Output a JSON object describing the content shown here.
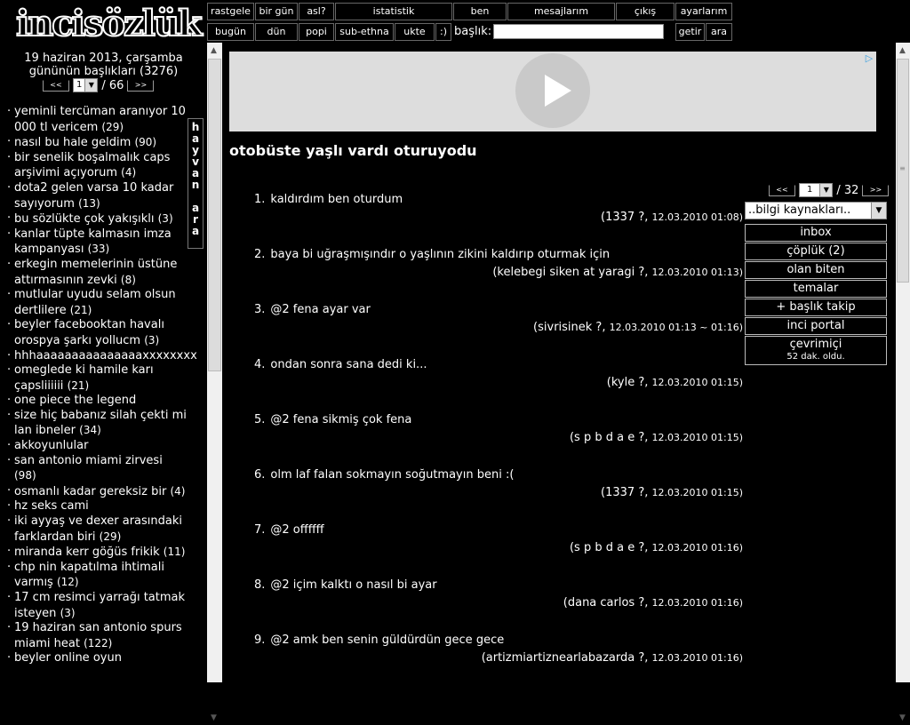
{
  "logo": {
    "text": "incisözlük"
  },
  "left": {
    "date_line1": "19 haziran 2013, çarşamba",
    "date_line2": "gününün başlıkları (3276)",
    "pager": {
      "prev": "<<",
      "page": "1",
      "total": "/ 66",
      "next": ">>"
    },
    "side_tab": [
      "h",
      "a",
      "y",
      "v",
      "a",
      "n",
      "",
      "a",
      "r",
      "a"
    ],
    "topics": [
      {
        "text": "yeminli tercüman aranıyor 10 000 tl vericem",
        "count": "(29)"
      },
      {
        "text": "nasıl bu hale geldim",
        "count": "(90)"
      },
      {
        "text": "bir senelik boşalmalık caps arşivimi açıyorum",
        "count": "(4)"
      },
      {
        "text": "dota2 gelen varsa 10 kadar sayıyorum",
        "count": "(13)"
      },
      {
        "text": "bu sözlükte çok yakışıklı",
        "count": "(3)"
      },
      {
        "text": "kanlar tüpte kalmasın imza kampanyası",
        "count": "(33)"
      },
      {
        "text": "erkegin memelerinin üstüne attırmasının zevki",
        "count": "(8)"
      },
      {
        "text": "mutlular uyudu selam olsun dertlilere",
        "count": "(21)"
      },
      {
        "text": "beyler facebooktan havalı orospya şarkı yollucm",
        "count": "(3)"
      },
      {
        "text": "hhhaaaaaaaaaaaaaaaxxxxxxxx",
        "count": ""
      },
      {
        "text": "omeglede ki hamile karı çapsliiiiii",
        "count": "(21)"
      },
      {
        "text": "one piece the legend",
        "count": ""
      },
      {
        "text": "size hiç babanız silah çekti mi lan ibneler",
        "count": "(34)"
      },
      {
        "text": "akkoyunlular",
        "count": ""
      },
      {
        "text": "san antonio miami zirvesi",
        "count": "(98)"
      },
      {
        "text": "osmanlı kadar gereksiz bir",
        "count": "(4)"
      },
      {
        "text": "hz seks cami",
        "count": ""
      },
      {
        "text": "iki ayyaş ve dexer arasındaki farklardan biri",
        "count": "(29)"
      },
      {
        "text": "miranda kerr göğüs frikik",
        "count": "(11)"
      },
      {
        "text": "chp nin kapatılma ihtimali varmış",
        "count": "(12)"
      },
      {
        "text": "17 cm resimci yarrağı tatmak isteyen",
        "count": "(3)"
      },
      {
        "text": "19 haziran san antonio spurs miami heat",
        "count": "(122)"
      },
      {
        "text": "beyler online oyun",
        "count": ""
      }
    ]
  },
  "nav": {
    "row1": [
      "rastgele",
      "bir gün",
      "asl?",
      "istatistik",
      "ben",
      "mesajlarım",
      "çıkış",
      "ayarlarım"
    ],
    "row2": [
      "bugün",
      "dün",
      "popi",
      "sub-ethna",
      "ukte",
      ":)"
    ],
    "baslik_label": "başlık:",
    "getir": "getir",
    "ara": "ara"
  },
  "topic": {
    "title": "otobüste yaşlı vardı oturuyodu",
    "pager": {
      "prev": "<<",
      "page": "1",
      "total": "/ 32",
      "next": ">>"
    },
    "sources": "..bilgi kaynakları..",
    "menu": [
      {
        "label": "inbox",
        "sub": ""
      },
      {
        "label": "çöplük (2)",
        "sub": ""
      },
      {
        "label": "olan biten",
        "sub": ""
      },
      {
        "label": "temalar",
        "sub": ""
      },
      {
        "label": "+ başlık takip",
        "sub": ""
      },
      {
        "label": "inci portal",
        "sub": ""
      },
      {
        "label": "çevrimiçi",
        "sub": "52 dak. oldu."
      }
    ],
    "entries": [
      {
        "num": "1.",
        "text": "kaldırdım ben oturdum",
        "author": "(1337 ?,",
        "meta": "12.03.2010 01:08)"
      },
      {
        "num": "2.",
        "text": "baya bi uğraşmışındır o yaşlının zikini kaldırıp oturmak için",
        "author": "(kelebegi siken at yaragi ?,",
        "meta": "12.03.2010 01:13)"
      },
      {
        "num": "3.",
        "text": "@2 fena ayar var",
        "author": "(sivrisinek ?,",
        "meta": "12.03.2010 01:13 ~ 01:16)"
      },
      {
        "num": "4.",
        "text": "ondan sonra sana dedi ki...",
        "author": "(kyle ?,",
        "meta": "12.03.2010 01:15)"
      },
      {
        "num": "5.",
        "text": "@2 fena sikmiş çok fena",
        "author": "(s p b d a e ?,",
        "meta": "12.03.2010 01:15)"
      },
      {
        "num": "6.",
        "text": "olm laf falan sokmayın soğutmayın beni :(",
        "author": "(1337 ?,",
        "meta": "12.03.2010 01:15)"
      },
      {
        "num": "7.",
        "text": "@2 offffff",
        "author": "(s p b d a e ?,",
        "meta": "12.03.2010 01:16)"
      },
      {
        "num": "8.",
        "text": "@2 içim kalktı o nasıl bi ayar",
        "author": "(dana carlos ?,",
        "meta": "12.03.2010 01:16)"
      },
      {
        "num": "9.",
        "text": "@2 amk ben senin güldürdün gece gece",
        "author": "(artizmiartiznearlabazarda ?,",
        "meta": "12.03.2010 01:16)"
      }
    ]
  }
}
